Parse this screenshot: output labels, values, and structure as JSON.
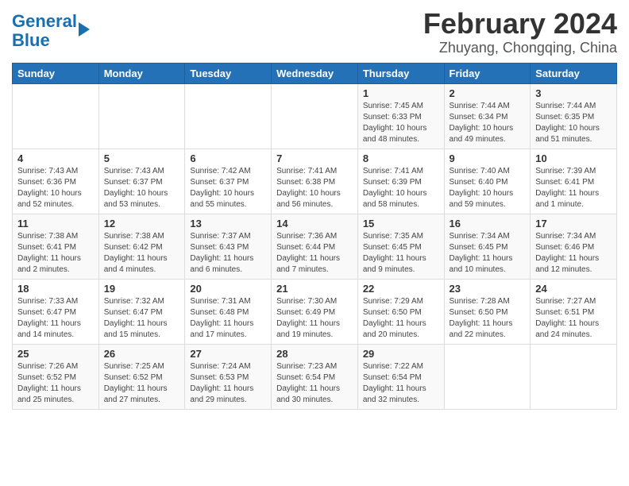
{
  "logo": {
    "text_general": "General",
    "text_blue": "Blue"
  },
  "title": "February 2024",
  "subtitle": "Zhuyang, Chongqing, China",
  "days_of_week": [
    "Sunday",
    "Monday",
    "Tuesday",
    "Wednesday",
    "Thursday",
    "Friday",
    "Saturday"
  ],
  "weeks": [
    [
      {
        "day": "",
        "info": ""
      },
      {
        "day": "",
        "info": ""
      },
      {
        "day": "",
        "info": ""
      },
      {
        "day": "",
        "info": ""
      },
      {
        "day": "1",
        "info": "Sunrise: 7:45 AM\nSunset: 6:33 PM\nDaylight: 10 hours and 48 minutes."
      },
      {
        "day": "2",
        "info": "Sunrise: 7:44 AM\nSunset: 6:34 PM\nDaylight: 10 hours and 49 minutes."
      },
      {
        "day": "3",
        "info": "Sunrise: 7:44 AM\nSunset: 6:35 PM\nDaylight: 10 hours and 51 minutes."
      }
    ],
    [
      {
        "day": "4",
        "info": "Sunrise: 7:43 AM\nSunset: 6:36 PM\nDaylight: 10 hours and 52 minutes."
      },
      {
        "day": "5",
        "info": "Sunrise: 7:43 AM\nSunset: 6:37 PM\nDaylight: 10 hours and 53 minutes."
      },
      {
        "day": "6",
        "info": "Sunrise: 7:42 AM\nSunset: 6:37 PM\nDaylight: 10 hours and 55 minutes."
      },
      {
        "day": "7",
        "info": "Sunrise: 7:41 AM\nSunset: 6:38 PM\nDaylight: 10 hours and 56 minutes."
      },
      {
        "day": "8",
        "info": "Sunrise: 7:41 AM\nSunset: 6:39 PM\nDaylight: 10 hours and 58 minutes."
      },
      {
        "day": "9",
        "info": "Sunrise: 7:40 AM\nSunset: 6:40 PM\nDaylight: 10 hours and 59 minutes."
      },
      {
        "day": "10",
        "info": "Sunrise: 7:39 AM\nSunset: 6:41 PM\nDaylight: 11 hours and 1 minute."
      }
    ],
    [
      {
        "day": "11",
        "info": "Sunrise: 7:38 AM\nSunset: 6:41 PM\nDaylight: 11 hours and 2 minutes."
      },
      {
        "day": "12",
        "info": "Sunrise: 7:38 AM\nSunset: 6:42 PM\nDaylight: 11 hours and 4 minutes."
      },
      {
        "day": "13",
        "info": "Sunrise: 7:37 AM\nSunset: 6:43 PM\nDaylight: 11 hours and 6 minutes."
      },
      {
        "day": "14",
        "info": "Sunrise: 7:36 AM\nSunset: 6:44 PM\nDaylight: 11 hours and 7 minutes."
      },
      {
        "day": "15",
        "info": "Sunrise: 7:35 AM\nSunset: 6:45 PM\nDaylight: 11 hours and 9 minutes."
      },
      {
        "day": "16",
        "info": "Sunrise: 7:34 AM\nSunset: 6:45 PM\nDaylight: 11 hours and 10 minutes."
      },
      {
        "day": "17",
        "info": "Sunrise: 7:34 AM\nSunset: 6:46 PM\nDaylight: 11 hours and 12 minutes."
      }
    ],
    [
      {
        "day": "18",
        "info": "Sunrise: 7:33 AM\nSunset: 6:47 PM\nDaylight: 11 hours and 14 minutes."
      },
      {
        "day": "19",
        "info": "Sunrise: 7:32 AM\nSunset: 6:47 PM\nDaylight: 11 hours and 15 minutes."
      },
      {
        "day": "20",
        "info": "Sunrise: 7:31 AM\nSunset: 6:48 PM\nDaylight: 11 hours and 17 minutes."
      },
      {
        "day": "21",
        "info": "Sunrise: 7:30 AM\nSunset: 6:49 PM\nDaylight: 11 hours and 19 minutes."
      },
      {
        "day": "22",
        "info": "Sunrise: 7:29 AM\nSunset: 6:50 PM\nDaylight: 11 hours and 20 minutes."
      },
      {
        "day": "23",
        "info": "Sunrise: 7:28 AM\nSunset: 6:50 PM\nDaylight: 11 hours and 22 minutes."
      },
      {
        "day": "24",
        "info": "Sunrise: 7:27 AM\nSunset: 6:51 PM\nDaylight: 11 hours and 24 minutes."
      }
    ],
    [
      {
        "day": "25",
        "info": "Sunrise: 7:26 AM\nSunset: 6:52 PM\nDaylight: 11 hours and 25 minutes."
      },
      {
        "day": "26",
        "info": "Sunrise: 7:25 AM\nSunset: 6:52 PM\nDaylight: 11 hours and 27 minutes."
      },
      {
        "day": "27",
        "info": "Sunrise: 7:24 AM\nSunset: 6:53 PM\nDaylight: 11 hours and 29 minutes."
      },
      {
        "day": "28",
        "info": "Sunrise: 7:23 AM\nSunset: 6:54 PM\nDaylight: 11 hours and 30 minutes."
      },
      {
        "day": "29",
        "info": "Sunrise: 7:22 AM\nSunset: 6:54 PM\nDaylight: 11 hours and 32 minutes."
      },
      {
        "day": "",
        "info": ""
      },
      {
        "day": "",
        "info": ""
      }
    ]
  ]
}
